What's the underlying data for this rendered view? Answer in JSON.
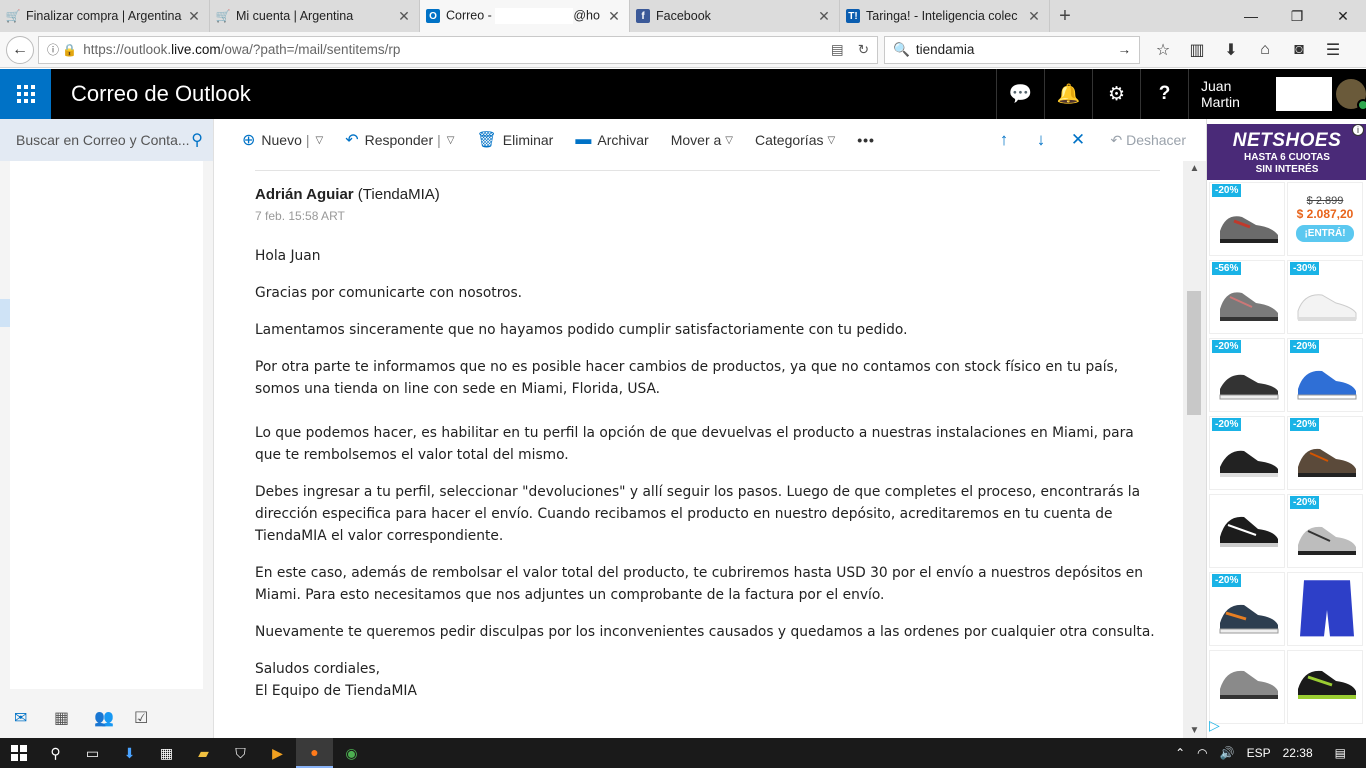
{
  "browser": {
    "tabs": [
      {
        "title": "Finalizar compra | Argentina",
        "icon": "cart-icon",
        "icon_color": "#e8641b"
      },
      {
        "title": "Mi cuenta | Argentina",
        "icon": "cart-icon",
        "icon_color": "#e8641b"
      },
      {
        "title_prefix": "Correo - ",
        "title_suffix": "@ho",
        "icon": "outlook-icon",
        "icon_color": "#0072c6",
        "active": true
      },
      {
        "title": "Facebook",
        "icon": "facebook-icon",
        "icon_color": "#3b5998"
      },
      {
        "title": "Taringa! - Inteligencia colec",
        "icon": "taringa-icon",
        "icon_color": "#0a5db0"
      }
    ],
    "url_prefix": "https://outlook.",
    "url_domain": "live.com",
    "url_path": "/owa/?path=/mail/sentitems/rp",
    "search_value": "tiendamia"
  },
  "outlook": {
    "app_title": "Correo de Outlook",
    "user_name": "Juan Martin",
    "search_placeholder": "Buscar en Correo y Conta...",
    "commands": {
      "new": "Nuevo",
      "reply": "Responder",
      "delete": "Eliminar",
      "archive": "Archivar",
      "move": "Mover a",
      "categories": "Categorías",
      "more": "•••",
      "undo": "Deshacer"
    },
    "accent_color": "#0072c6"
  },
  "message": {
    "sender_name": "Adrián Aguiar",
    "sender_org": "(TiendaMIA)",
    "date": "7 feb. 15:58 ART",
    "greeting": "Hola Juan",
    "p1": "Gracias por comunicarte con nosotros.",
    "p2": "Lamentamos sinceramente que no hayamos podido cumplir satisfactoriamente con tu pedido.",
    "p3": "Por otra parte te informamos que no es posible hacer cambios de productos, ya que no contamos con stock físico en tu país, somos una tienda on line con sede en Miami, Florida, USA.",
    "p4": "Lo que podemos hacer, es habilitar en tu perfil la opción de que devuelvas el producto a nuestras instalaciones en Miami, para que te rembolsemos el valor total del mismo.",
    "p5": "Debes ingresar a tu perfil, seleccionar \"devoluciones\" y allí seguir los pasos. Luego de que completes el proceso, encontrarás la dirección especifica para hacer el envío. Cuando recibamos el producto en nuestro depósito, acreditaremos en tu cuenta de TiendaMIA el valor correspondiente.",
    "p6": "En este caso, además de rembolsar el valor total del producto, te cubriremos hasta USD 30 por el envío a nuestros depósitos en Miami. Para esto necesitamos que nos adjuntes un comprobante de la factura por el envío.",
    "p7": "Nuevamente te queremos pedir disculpas por los inconvenientes causados y quedamos a las ordenes por cualquier otra consulta.",
    "closing": "Saludos cordiales,",
    "signature": "El Equipo de TiendaMIA"
  },
  "ad": {
    "brand": "NETSHOES",
    "promo_line1": "HASTA 6 CUOTAS",
    "promo_line2": "SIN INTERÉS",
    "old_price": "$ 2.899",
    "new_price": "$ 2.087,20",
    "cta": "¡ENTRÁ!",
    "badges": [
      "-20%",
      "-56%",
      "-30%",
      "-20%",
      "-20%",
      "-20%",
      "-20%",
      "-20%",
      "-20%"
    ]
  },
  "taskbar": {
    "language": "ESP",
    "time": "22:38"
  }
}
